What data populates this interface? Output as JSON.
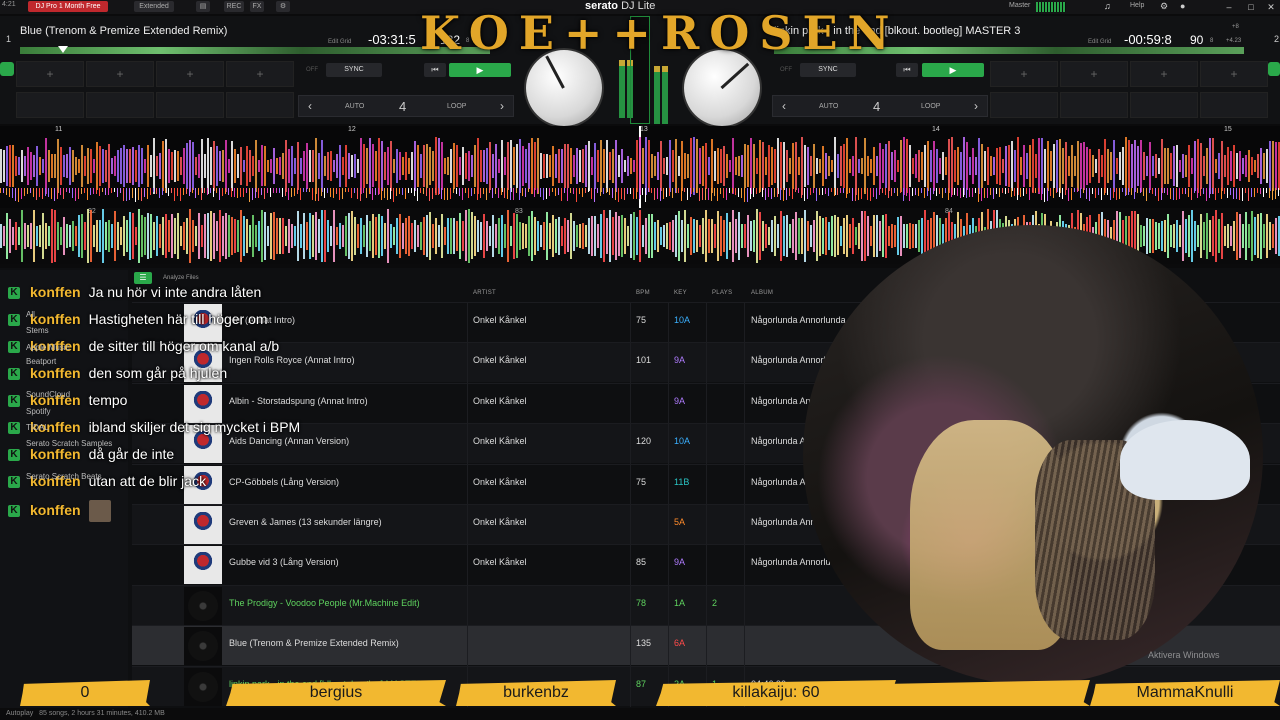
{
  "topbar": {
    "time": "4:21",
    "promo": "DJ Pro 1 Month Free",
    "mode_left": "Extended",
    "rec_label": "REC",
    "fx_label": "FX",
    "brand": "serato",
    "brand_product": "DJ Lite",
    "master_label": "Master",
    "help_label": "Help",
    "gear_icon": "gear-icon",
    "user_icon": "user-icon"
  },
  "overlay": {
    "title": "KOE++ROSEN"
  },
  "deck1": {
    "number": "1",
    "title": "Blue (Trenom & Premize Extended Remix)",
    "edit_grid": "Edit Grid",
    "time": "-03:31:5",
    "bpm": "132",
    "bpm_suffix": "8",
    "sync": "SYNC",
    "off": "OFF",
    "loop_auto": "AUTO",
    "loop_num": "4",
    "loop_label": "LOOP"
  },
  "deck2": {
    "number": "2",
    "title": "linkin park - in the end [blkout. bootleg] MASTER 3",
    "edit_grid": "Edit Grid",
    "time": "-00:59:8",
    "bpm": "90",
    "bpm_suffix": "8",
    "pitch": "+4.23",
    "pitch2": "+8",
    "sync": "SYNC",
    "off": "OFF",
    "loop_auto": "AUTO",
    "loop_num": "4",
    "loop_label": "LOOP"
  },
  "waveform_markers": [
    "11",
    "12",
    "13",
    "14",
    "15"
  ],
  "waveform2_markers": [
    "82",
    "83",
    "84"
  ],
  "library": {
    "analyze_files": "Analyze Files",
    "columns": {
      "artist": "ARTIST",
      "bpm": "BPM",
      "key": "KEY",
      "plays": "PLAYS",
      "album": "ALBUM"
    },
    "sidebar": [
      "All",
      "Stems",
      "Apple Music",
      "Beatport",
      "SoundCloud",
      "Spotify",
      "TIDAL",
      "Serato Scratch Samples",
      "Serato Scratch Beats"
    ],
    "rows": [
      {
        "title": "Hej (Annat Intro)",
        "artist": "Onkel Kånkel",
        "bpm": "75",
        "key": "10A",
        "key_class": "key-blue",
        "plays": "",
        "album": "Någorlunda Annorlunda",
        "art": "poster"
      },
      {
        "title": "Ingen Rolls Royce (Annat Intro)",
        "artist": "Onkel Kånkel",
        "bpm": "101",
        "key": "9A",
        "key_class": "key-purple",
        "plays": "",
        "album": "Någorlunda Annorlunda",
        "art": "poster"
      },
      {
        "title": "Albin - Storstadspung (Annat Intro)",
        "artist": "Onkel Kånkel",
        "bpm": "",
        "key": "9A",
        "key_class": "key-purple",
        "plays": "",
        "album": "Någorlunda Annorlunda",
        "art": "poster"
      },
      {
        "title": "Aids Dancing (Annan Version)",
        "artist": "Onkel Kånkel",
        "bpm": "120",
        "key": "10A",
        "key_class": "key-blue",
        "plays": "",
        "album": "Någorlunda Annorlunda",
        "art": "poster"
      },
      {
        "title": "CP-Göbbels (Lång Version)",
        "artist": "Onkel Kånkel",
        "bpm": "75",
        "key": "11B",
        "key_class": "key-teal",
        "plays": "",
        "album": "Någorlunda Annorlunda",
        "art": "poster"
      },
      {
        "title": "Greven & James (13 sekunder längre)",
        "artist": "Onkel Kånkel",
        "bpm": "",
        "key": "5A",
        "key_class": "key-orange",
        "plays": "",
        "album": "Någorlunda Annorlunda",
        "art": "poster"
      },
      {
        "title": "Gubbe vid 3 (Lång Version)",
        "artist": "Onkel Kånkel",
        "bpm": "85",
        "key": "9A",
        "key_class": "key-purple",
        "plays": "",
        "album": "Någorlunda Annorlunda",
        "art": "poster"
      },
      {
        "title": "The Prodigy - Voodoo People (Mr.Machine Edit)",
        "artist": "",
        "bpm": "78",
        "key": "1A",
        "key_class": "key-green",
        "plays": "2",
        "album": "",
        "art": "vinyl",
        "green": true
      },
      {
        "title": "Blue (Trenom & Premize Extended Remix)",
        "artist": "",
        "bpm": "135",
        "key": "6A",
        "key_class": "key-red",
        "plays": "",
        "album": "",
        "art": "vinyl",
        "selected": true
      },
      {
        "title": "linkin park - in the end [blkout. bootleg] MASTER 3",
        "artist": "",
        "bpm": "87",
        "key": "2A",
        "key_class": "key-green",
        "plays": "1",
        "album": "04:46.90",
        "art": "vinyl",
        "green": true
      }
    ],
    "status": "85 songs, 2 hours 31 minutes, 410.2 MB",
    "autoplay": "Autoplay"
  },
  "chat": [
    {
      "user": "konffen",
      "msg": "Ja nu hör vi inte andra låten"
    },
    {
      "user": "konffen",
      "msg": "Hastigheten här till höger om"
    },
    {
      "user": "konffen",
      "msg": "de sitter till höger om kanal a/b"
    },
    {
      "user": "konffen",
      "msg": "den som går på hjulen"
    },
    {
      "user": "konffen",
      "msg": "tempo"
    },
    {
      "user": "konffen",
      "msg": "ibland skiljer det sig mycket i BPM"
    },
    {
      "user": "konffen",
      "msg": "då går de inte"
    },
    {
      "user": "konffen",
      "msg": "utan att de blir jack"
    },
    {
      "user": "konffen",
      "msg": ""
    }
  ],
  "webcam": {
    "watermark": "Aktivera Windows"
  },
  "ticker": [
    "0",
    "bergius",
    "burkenbz",
    "killakaiju: 60",
    "",
    "MammaKnulli"
  ],
  "colors": {
    "accent_green": "#2aa84a",
    "chat_user": "#f2b830",
    "ticker_bg": "#f2b830"
  }
}
